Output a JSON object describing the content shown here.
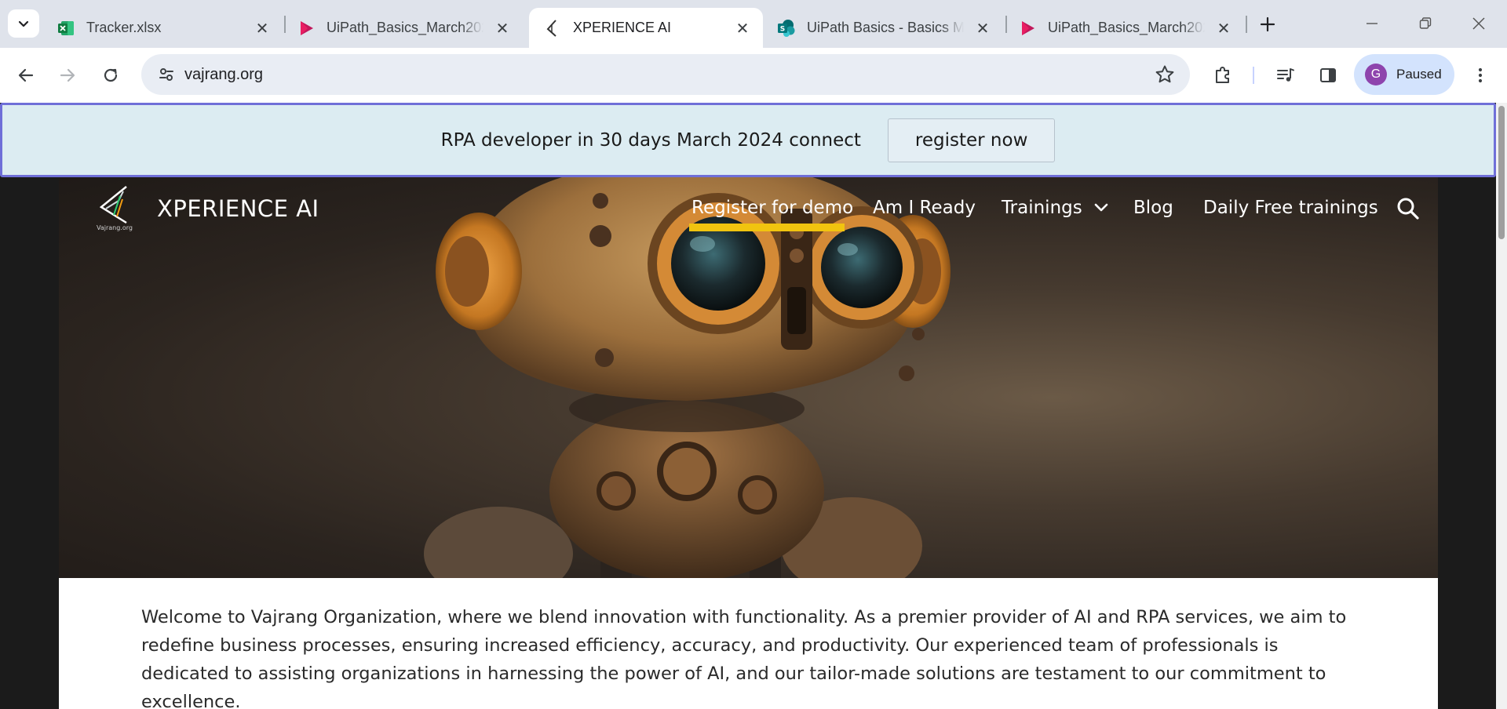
{
  "browser": {
    "tabs": [
      {
        "title": "Tracker.xlsx",
        "icon": "excel-icon",
        "active": false
      },
      {
        "title": "UiPath_Basics_March2024",
        "icon": "media-play-icon",
        "active": false
      },
      {
        "title": "XPERIENCE AI",
        "icon": "xperience-logo-icon",
        "active": true
      },
      {
        "title": "UiPath Basics - Basics March",
        "icon": "sharepoint-icon",
        "active": false
      },
      {
        "title": "UiPath_Basics_March2024",
        "icon": "media-play-icon",
        "active": false
      }
    ],
    "url": "vajrang.org",
    "profile": {
      "initial": "G",
      "status": "Paused"
    },
    "colors": {
      "tabstrip": "#dfe3eb",
      "omnibox": "#e9edf4",
      "profile_chip": "#d3e3fd",
      "avatar": "#8e44ad"
    }
  },
  "page": {
    "announcement": {
      "text": "RPA developer in 30 days March 2024 connect",
      "button": "register now"
    },
    "site": {
      "logo_caption": "Vajrang.org",
      "brand": "XPERIENCE AI"
    },
    "nav": {
      "items": [
        "Register for demo",
        "Am I Ready",
        "Trainings",
        "Blog",
        "Daily Free trainings"
      ],
      "active_index": 0,
      "accent": "#f1c40f"
    },
    "intro": "Welcome to Vajrang Organization, where we blend innovation with functionality. As a premier provider of AI and RPA services, we aim to redefine business processes, ensuring increased efficiency, accuracy, and productivity. Our experienced team of professionals is dedicated to assisting organizations in harnessing the power of AI, and our tailor-made solutions are testament to our commitment to excellence."
  }
}
